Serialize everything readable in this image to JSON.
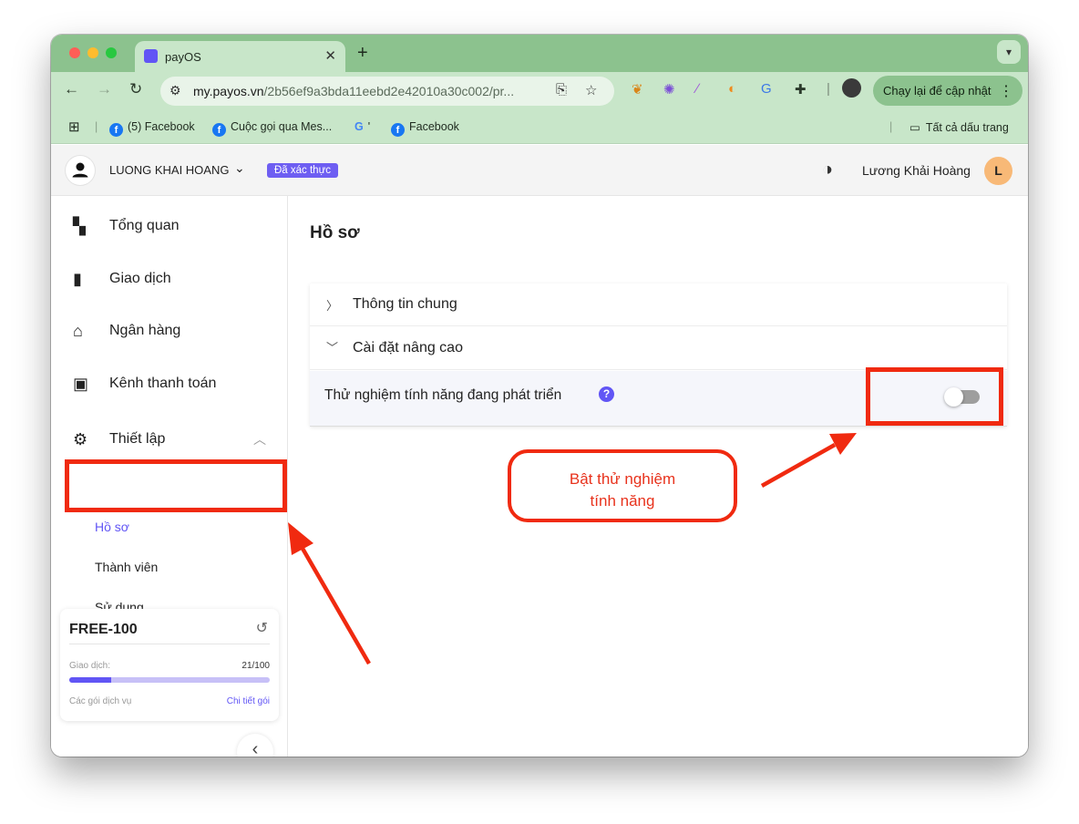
{
  "browser": {
    "tab_title": "payOS",
    "url_host": "my.payos.vn",
    "url_path": "/2b56ef9a3bda11eebd2e42010a30c002/pr...",
    "update_button": "Chạy lại để cập nhật",
    "bookmarks": [
      "(5) Facebook",
      "Cuộc gọi qua Mes...",
      "'",
      "Facebook"
    ],
    "all_bookmarks": "Tất cả dấu trang"
  },
  "header": {
    "org_name": "LUONG KHAI HOANG",
    "verified_badge": "Đã xác thực",
    "user_name": "Lương Khải Hoàng",
    "avatar_initial": "L"
  },
  "sidebar": {
    "items": [
      {
        "label": "Tổng quan",
        "icon": "dashboard-icon"
      },
      {
        "label": "Giao dịch",
        "icon": "bar-chart-icon"
      },
      {
        "label": "Ngân hàng",
        "icon": "bank-icon"
      },
      {
        "label": "Kênh thanh toán",
        "icon": "wallet-icon"
      },
      {
        "label": "Thiết lập",
        "icon": "gear-icon"
      }
    ],
    "subitems": [
      "Hồ sơ",
      "Thành viên",
      "Sử dụng"
    ],
    "plan": {
      "name": "FREE-100",
      "usage_label": "Giao dịch:",
      "usage_count": "21/100",
      "usage_fraction": 0.21,
      "services_label": "Các gói dịch vụ",
      "details_link": "Chi tiết gói"
    }
  },
  "main": {
    "title": "Hồ sơ",
    "sections": [
      "Thông tin chung",
      "Cài đặt nâng cao"
    ],
    "setting_label": "Thử nghiệm tính năng đang phát triển",
    "setting_enabled": false
  },
  "annotation": {
    "line1": "Bật thử nghiệm",
    "line2": "tính năng"
  },
  "colors": {
    "accent": "#6155f5",
    "annotation_red": "#f02a10",
    "chrome_green": "#c8e6c9"
  }
}
